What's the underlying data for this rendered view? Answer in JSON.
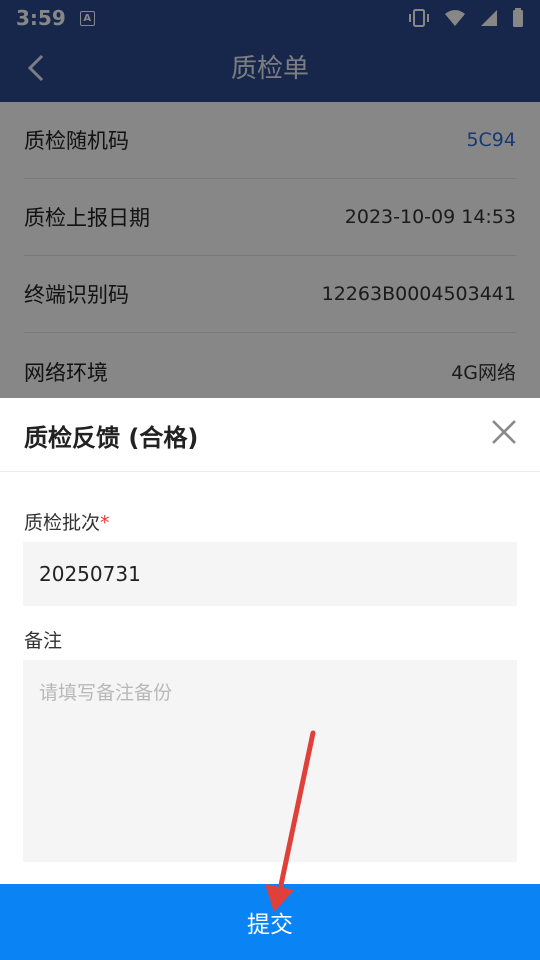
{
  "status_bar": {
    "time": "3:59",
    "notification_badge": "A",
    "icons": [
      "vibrate-icon",
      "wifi-icon",
      "signal-icon",
      "battery-icon"
    ]
  },
  "app_bar": {
    "title": "质检单",
    "back_icon": "chevron-left-icon"
  },
  "details": [
    {
      "label": "质检随机码",
      "value": "5C94"
    },
    {
      "label": "质检上报日期",
      "value": "2023-10-09 14:53"
    },
    {
      "label": "终端识别码",
      "value": "12263B0004503441"
    },
    {
      "label": "网络环境",
      "value": "4G网络"
    }
  ],
  "sheet": {
    "title": "质检反馈 (合格)",
    "close_icon": "close-icon",
    "batch_label": "质检批次",
    "batch_required_mark": "*",
    "batch_value": "20250731",
    "remark_label": "备注",
    "remark_placeholder": "请填写备注备份",
    "submit_label": "提交"
  },
  "colors": {
    "header": "#2d4a8e",
    "accent_value": "#2e6bd8",
    "submit": "#0a84f5",
    "required": "#e53935",
    "annotation_arrow": "#e0403a"
  }
}
